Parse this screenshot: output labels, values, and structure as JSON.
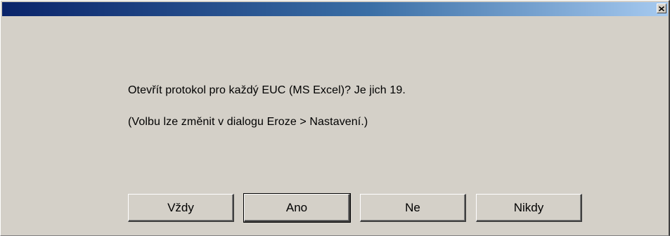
{
  "window": {
    "title": "",
    "close_label": "×"
  },
  "message": {
    "line1": "Otevřít protokol pro každý EUC (MS Excel)? Je jich 19.",
    "line2": "(Volbu lze změnit v dialogu Eroze > Nastavení.)"
  },
  "buttons": {
    "always": "Vždy",
    "yes": "Ano",
    "no": "Ne",
    "never": "Nikdy"
  },
  "colors": {
    "titlebar_start": "#0a246a",
    "titlebar_end": "#a6caf0",
    "dialog_face": "#d4d0c8"
  }
}
